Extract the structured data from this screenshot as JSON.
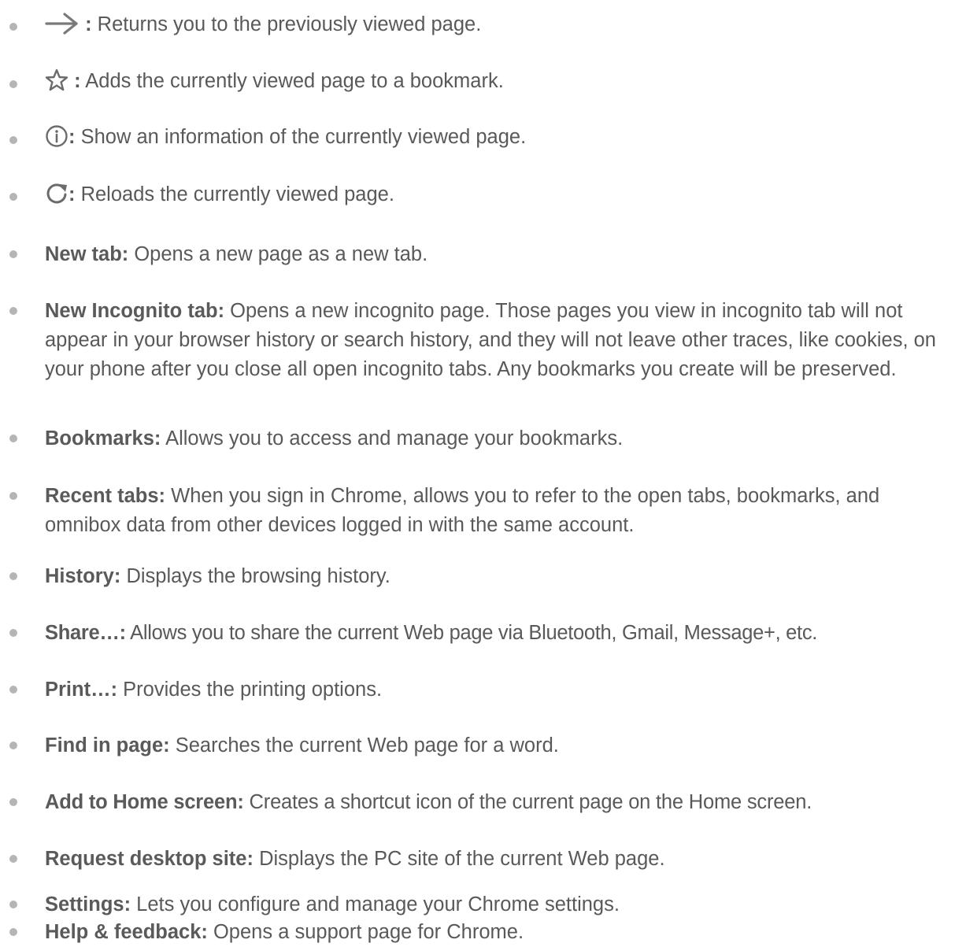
{
  "icon_items": [
    {
      "icon": "arrow-right-icon",
      "separator": " :",
      "description": " Returns you to the previously viewed page."
    },
    {
      "icon": "star-outline-icon",
      "separator": " :",
      "description": " Adds the currently viewed page to a bookmark."
    },
    {
      "icon": "info-circle-icon",
      "separator": ":",
      "description": " Show an information of the currently viewed page."
    },
    {
      "icon": "reload-icon",
      "separator": ":",
      "description": " Reloads the currently viewed page."
    }
  ],
  "menu_items": [
    {
      "term": "New tab:",
      "description": " Opens a new page as a new tab."
    },
    {
      "term": "New Incognito tab:",
      "description": " Opens a new incognito page. Those pages you view in incognito tab will not appear in your browser history or search history, and they will not leave other traces, like cookies, on your phone after you close all open incognito tabs. Any bookmarks you create will be preserved."
    },
    {
      "term": "Bookmarks:",
      "description": " Allows you to access and manage your bookmarks."
    },
    {
      "term": "Recent tabs:",
      "description": " When you sign in Chrome, allows you to refer to the open tabs, bookmarks, and omnibox data from other devices logged in with the same account."
    },
    {
      "term": "History:",
      "description": " Displays the browsing history."
    },
    {
      "term": "Share…:",
      "description": " Allows you to share the current Web page via Bluetooth, Gmail, Message+, etc."
    },
    {
      "term": "Print…:",
      "description": " Provides the printing options."
    },
    {
      "term": "Find in page:",
      "description": " Searches the current Web page for a word."
    },
    {
      "term": "Add to Home screen:",
      "description": " Creates a shortcut icon of the current page on the Home screen."
    },
    {
      "term": "Request desktop site:",
      "description": " Displays the PC site of the current Web page."
    },
    {
      "term": "Settings:",
      "description": " Lets you configure and manage your Chrome settings."
    },
    {
      "term": "Help & feedback:",
      "description": " Opens a support page for Chrome."
    }
  ],
  "colors": {
    "text": "#595959",
    "bullet": "#b5b5b5",
    "icon": "#6b6b6b"
  }
}
